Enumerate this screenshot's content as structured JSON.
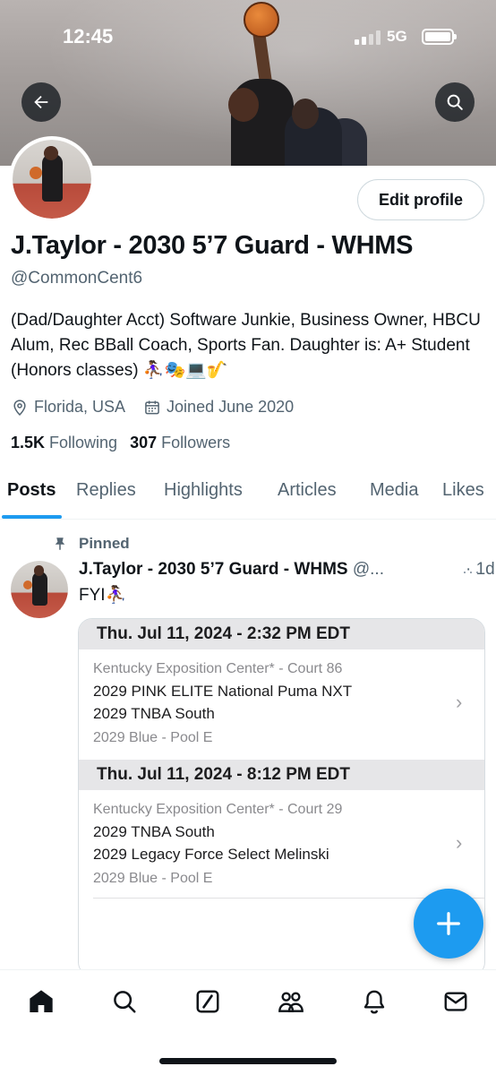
{
  "status_bar": {
    "time": "12:45",
    "network": "5G"
  },
  "header": {
    "back_icon": "arrow-left-icon",
    "search_icon": "search-icon"
  },
  "profile": {
    "edit_label": "Edit profile",
    "name": "J.Taylor - 2030 5’7 Guard - WHMS",
    "handle": "@CommonCent6",
    "bio": "(Dad/Daughter Acct) Software Junkie, Business Owner, HBCU Alum, Rec BBall Coach, Sports Fan. Daughter is: A+ Student (Honors classes) ⛹🏾‍♀️🎭💻🎷",
    "location": "Florida, USA",
    "joined": "Joined June 2020",
    "following_count": "1.5K",
    "following_label": "Following",
    "followers_count": "307",
    "followers_label": "Followers"
  },
  "tabs": [
    {
      "label": "Posts",
      "active": true
    },
    {
      "label": "Replies"
    },
    {
      "label": "Highlights"
    },
    {
      "label": "Articles"
    },
    {
      "label": "Media"
    },
    {
      "label": "Likes"
    }
  ],
  "post": {
    "pinned_label": "Pinned",
    "author": "J.Taylor - 2030 5’7 Guard - WHMS",
    "handle": "@...",
    "date": "1d",
    "more": "···",
    "text": "FYI⛹🏾‍♀️",
    "games": [
      {
        "header": "Thu. Jul 11, 2024 - 2:32 PM EDT",
        "venue": "Kentucky Exposition Center* - Court 86",
        "team1": "2029 PINK ELITE National Puma NXT",
        "team2": "2029 TNBA South",
        "pool": "2029 Blue - Pool E"
      },
      {
        "header": "Thu. Jul 11, 2024 - 8:12 PM EDT",
        "venue": "Kentucky Exposition Center* - Court 29",
        "team1": "2029 TNBA South",
        "team2": "2029 Legacy Force Select Melinski",
        "pool": "2029 Blue - Pool E"
      }
    ]
  },
  "bottom_nav": [
    "home-icon",
    "search-icon",
    "grok-icon",
    "communities-icon",
    "notifications-icon",
    "messages-icon"
  ],
  "colors": {
    "accent": "#1d9bf0",
    "text": "#0f1419",
    "secondary": "#536471"
  }
}
